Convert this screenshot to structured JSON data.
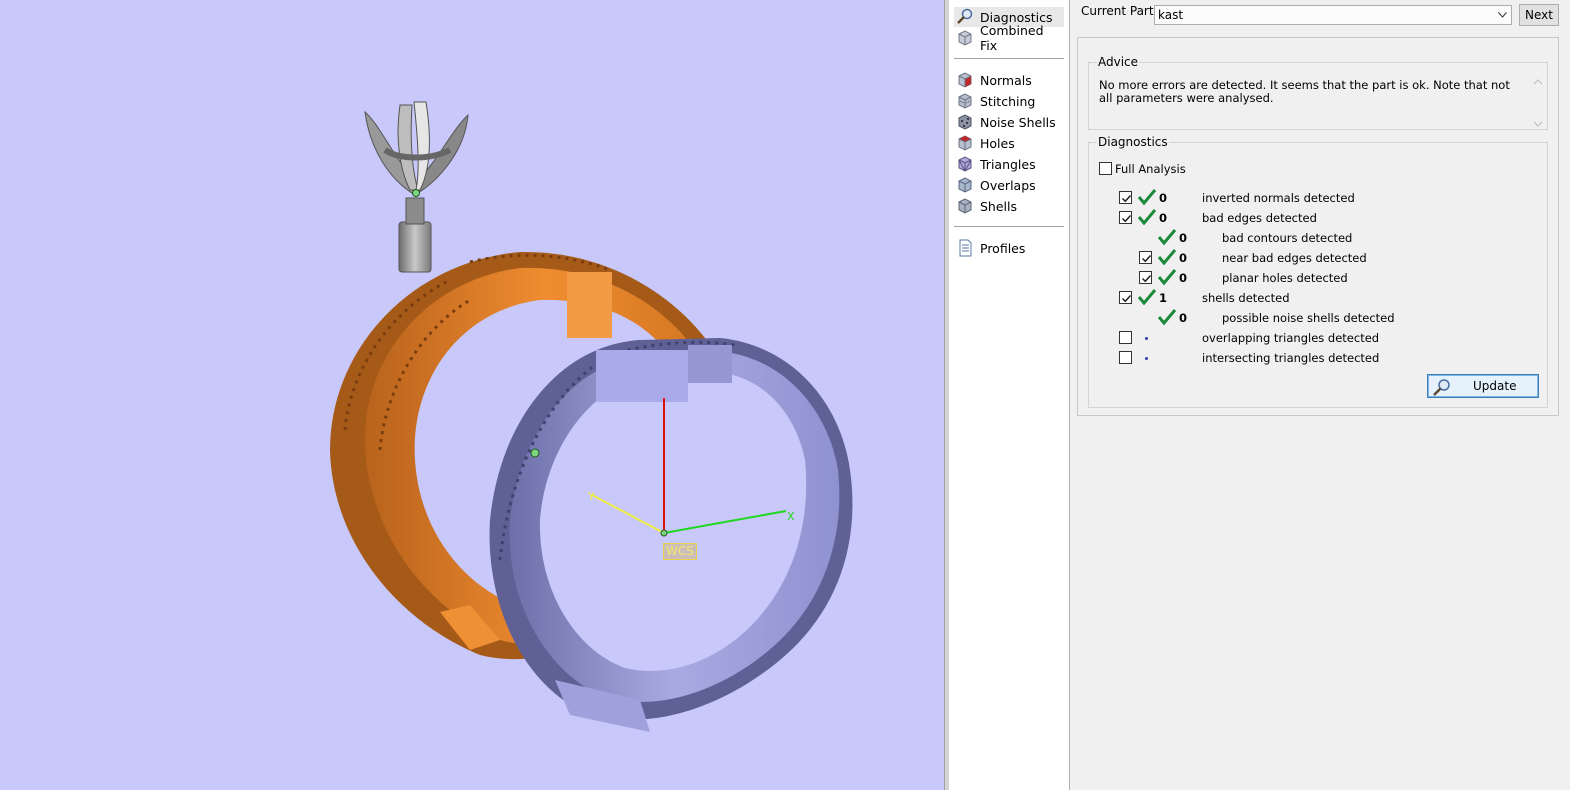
{
  "viewport": {
    "background": "#c8c8fa",
    "wcs_label": "WCS",
    "axis_y_label": "Y",
    "axis_x_label": "X"
  },
  "nav": {
    "items": [
      {
        "label": "Diagnostics",
        "icon": "magnifier-icon",
        "active": true
      },
      {
        "label": "Combined Fix",
        "icon": "cube-icon",
        "active": false
      },
      {
        "label": "Normals",
        "icon": "normals-cube-icon",
        "active": false
      },
      {
        "label": "Stitching",
        "icon": "stitching-cube-icon",
        "active": false
      },
      {
        "label": "Noise Shells",
        "icon": "noise-shells-cube-icon",
        "active": false
      },
      {
        "label": "Holes",
        "icon": "holes-cube-icon",
        "active": false
      },
      {
        "label": "Triangles",
        "icon": "triangles-cube-icon",
        "active": false
      },
      {
        "label": "Overlaps",
        "icon": "overlaps-cube-icon",
        "active": false
      },
      {
        "label": "Shells",
        "icon": "shells-cube-icon",
        "active": false
      },
      {
        "label": "Profiles",
        "icon": "document-icon",
        "active": false
      }
    ]
  },
  "panel": {
    "current_part_label": "Current Part:",
    "current_part_value": "kast",
    "next_label": "Next",
    "advice_title": "Advice",
    "advice_text": "No more errors are detected. It seems that the part is ok. Note that not all parameters were analysed.",
    "diagnostics_title": "Diagnostics",
    "full_analysis_label": "Full Analysis",
    "full_analysis_checked": false,
    "rows": [
      {
        "checkbox": true,
        "checked": true,
        "status": "ok",
        "count": "0",
        "label": "inverted normals detected",
        "indent": 0
      },
      {
        "checkbox": true,
        "checked": true,
        "status": "ok",
        "count": "0",
        "label": "bad edges detected",
        "indent": 0
      },
      {
        "checkbox": false,
        "checked": false,
        "status": "ok",
        "count": "0",
        "label": "bad contours detected",
        "indent": 1
      },
      {
        "checkbox": true,
        "checked": true,
        "status": "ok",
        "count": "0",
        "label": "near bad edges detected",
        "indent": 1
      },
      {
        "checkbox": true,
        "checked": true,
        "status": "ok",
        "count": "0",
        "label": "planar holes detected",
        "indent": 1
      },
      {
        "checkbox": true,
        "checked": true,
        "status": "ok",
        "count": "1",
        "label": "shells detected",
        "indent": 0
      },
      {
        "checkbox": false,
        "checked": false,
        "status": "ok",
        "count": "0",
        "label": "possible noise shells detected",
        "indent": 1
      },
      {
        "checkbox": true,
        "checked": false,
        "status": "pending",
        "count": "",
        "label": "overlapping triangles detected",
        "indent": 0
      },
      {
        "checkbox": true,
        "checked": false,
        "status": "pending",
        "count": "",
        "label": "intersecting triangles detected",
        "indent": 0
      }
    ],
    "update_label": "Update"
  }
}
